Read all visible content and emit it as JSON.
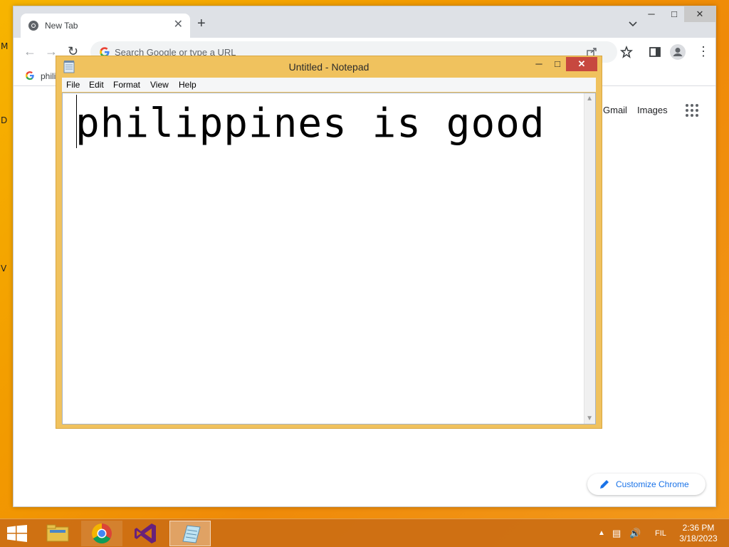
{
  "desktop": {
    "edge_letters": [
      "M",
      "D",
      "V"
    ]
  },
  "chrome": {
    "tab": {
      "title": "New Tab"
    },
    "omnibox": {
      "placeholder": "Search Google or type a URL"
    },
    "bookmark": {
      "label": "phili"
    },
    "ntp_links": {
      "gmail": "Gmail",
      "images": "Images"
    },
    "customize_label": "Customize Chrome"
  },
  "notepad": {
    "title": "Untitled - Notepad",
    "menu": [
      "File",
      "Edit",
      "Format",
      "View",
      "Help"
    ],
    "content": "philippines is good"
  },
  "taskbar": {
    "apps": [
      "file-explorer",
      "chrome",
      "visual-studio",
      "notepad"
    ],
    "language": "FIL",
    "time": "2:36 PM",
    "date": "3/18/2023"
  },
  "colors": {
    "desktop_bg": "#f29a00",
    "notepad_frame": "#f0c25e",
    "notepad_close": "#c7483f",
    "taskbar": "#cc6e14",
    "chrome_tabstrip": "#dee1e6",
    "link_blue": "#1a73e8"
  }
}
